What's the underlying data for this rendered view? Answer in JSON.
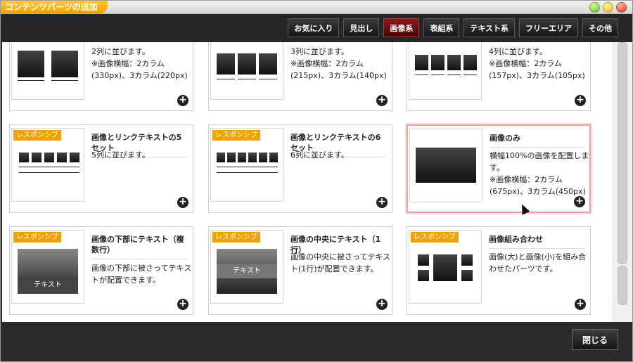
{
  "window": {
    "title": "コンテンツパーツの追加"
  },
  "tabs": [
    {
      "label": "お気に入り",
      "active": false
    },
    {
      "label": "見出し",
      "active": false
    },
    {
      "label": "画像系",
      "active": true
    },
    {
      "label": "表組系",
      "active": false
    },
    {
      "label": "テキスト系",
      "active": false
    },
    {
      "label": "フリーエリア",
      "active": false
    },
    {
      "label": "その他",
      "active": false
    }
  ],
  "cards": [
    {
      "badge": "",
      "title": "",
      "desc": "2列に並びます。\n※画像横幅：2カラム\n(330px)、3カラム(220px)"
    },
    {
      "badge": "",
      "title": "",
      "desc": "3列に並びます。\n※画像横幅：2カラム\n(215px)、3カラム(140px)"
    },
    {
      "badge": "",
      "title": "",
      "desc": "4列に並びます。\n※画像横幅：2カラム\n(157px)、3カラム(105px)"
    },
    {
      "badge": "レスポンシブ",
      "title": "画像とリンクテキストの5セット",
      "desc": "5列に並びます。"
    },
    {
      "badge": "レスポンシブ",
      "title": "画像とリンクテキストの6セット",
      "desc": "6列に並びます。"
    },
    {
      "badge": "",
      "title": "画像のみ",
      "desc": "横幅100%の画像を配置します。\n※画像横幅：2カラム\n(675px)、3カラム(450px)"
    },
    {
      "badge": "レスポンシブ",
      "title": "画像の下部にテキスト（複数行）",
      "desc": "画像の下部に被さってテキストが配置できます。"
    },
    {
      "badge": "レスポンシブ",
      "title": "画像の中央にテキスト（1行）",
      "desc": "画像の中央に被さってテキスト(1行)が配置できます。"
    },
    {
      "badge": "レスポンシブ",
      "title": "画像組み合わせ",
      "desc": "画像(大)と画像(小)を組み合わせたパーツです。"
    }
  ],
  "thumb_text": "テキスト",
  "footer": {
    "close_label": "閉じる"
  },
  "colors": {
    "accent_orange": "#f4a000",
    "active_tab": "#6a0a0a",
    "selected_border": "#f0a0a0"
  }
}
